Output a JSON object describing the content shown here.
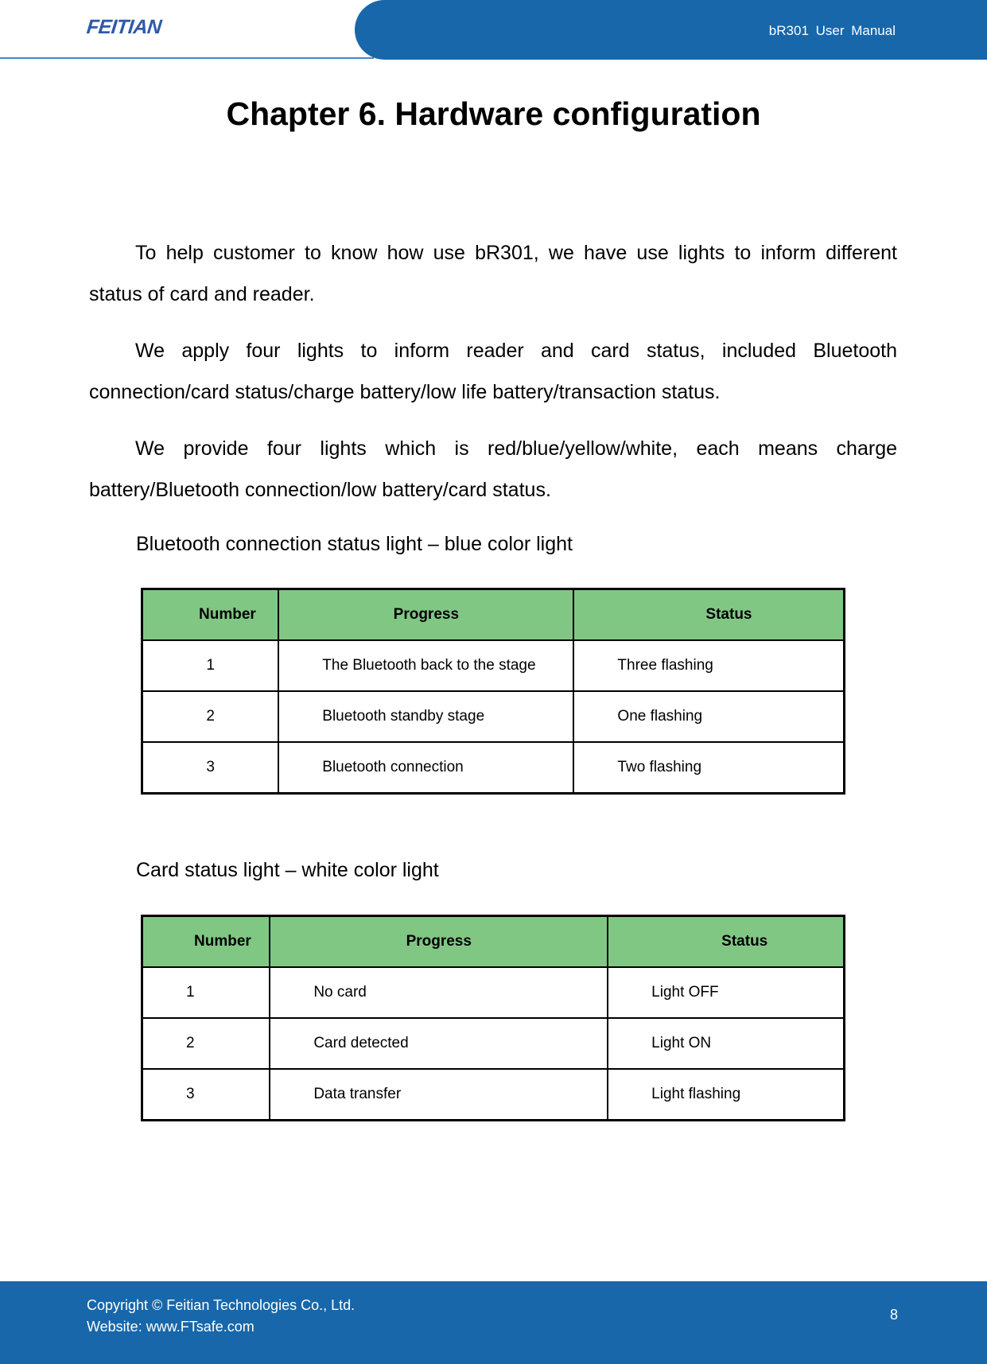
{
  "header": {
    "logo": "FEITIAN",
    "manual_title": "bR301  User  Manual"
  },
  "page_title": "Chapter 6.  Hardware configuration",
  "paragraphs": [
    "To help customer to know how use bR301, we have use lights to inform different status of card and reader.",
    "We apply four lights to inform reader and card status, included Bluetooth connection/card status/charge battery/low life battery/transaction status.",
    "We provide four lights which is red/blue/yellow/white, each means charge battery/Bluetooth connection/low battery/card status."
  ],
  "tables": [
    {
      "caption": "Bluetooth connection status light – blue color light",
      "columns": [
        "Number",
        "Progress",
        "Status"
      ],
      "rows": [
        [
          "1",
          "The Bluetooth back to the stage",
          "Three flashing"
        ],
        [
          "2",
          "Bluetooth standby stage",
          "One flashing"
        ],
        [
          "3",
          "Bluetooth connection",
          "Two flashing"
        ]
      ]
    },
    {
      "caption": "Card status light – white color light",
      "columns": [
        "Number",
        "Progress",
        "Status"
      ],
      "rows": [
        [
          "1",
          "No card",
          "Light OFF"
        ],
        [
          "2",
          "Card detected",
          "Light ON"
        ],
        [
          "3",
          "Data transfer",
          "Light flashing"
        ]
      ]
    }
  ],
  "footer": {
    "copyright": "Copyright © Feitian Technologies Co., Ltd.",
    "website": "Website: www.FTsafe.com",
    "page_number": "8"
  },
  "colors": {
    "brand_blue": "#1767AA",
    "table_header_green": "#81C784",
    "logo_blue": "#2F5AA8"
  }
}
